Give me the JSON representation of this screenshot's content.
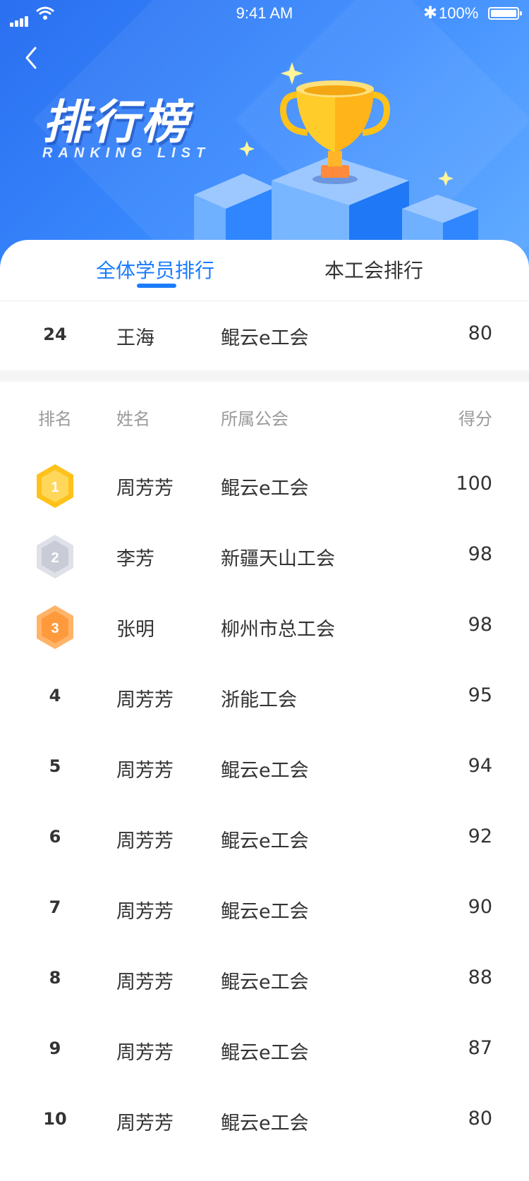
{
  "status": {
    "time": "9:41 AM",
    "battery": "100%"
  },
  "header": {
    "title": "排行榜",
    "subtitle": "RANKING LIST"
  },
  "tabs": [
    {
      "label": "全体学员排行",
      "active": true
    },
    {
      "label": "本工会排行",
      "active": false
    }
  ],
  "my_rank": {
    "rank": "24",
    "name": "王海",
    "union": "鲲云e工会",
    "score": "80"
  },
  "columns": {
    "rank": "排名",
    "name": "姓名",
    "union": "所属公会",
    "score": "得分"
  },
  "rows": [
    {
      "rank": "1",
      "name": "周芳芳",
      "union": "鲲云e工会",
      "score": "100"
    },
    {
      "rank": "2",
      "name": "李芳",
      "union": "新疆天山工会",
      "score": "98"
    },
    {
      "rank": "3",
      "name": "张明",
      "union": "柳州市总工会",
      "score": "98"
    },
    {
      "rank": "4",
      "name": "周芳芳",
      "union": "浙能工会",
      "score": "95"
    },
    {
      "rank": "5",
      "name": "周芳芳",
      "union": "鲲云e工会",
      "score": "94"
    },
    {
      "rank": "6",
      "name": "周芳芳",
      "union": "鲲云e工会",
      "score": "92"
    },
    {
      "rank": "7",
      "name": "周芳芳",
      "union": "鲲云e工会",
      "score": "90"
    },
    {
      "rank": "8",
      "name": "周芳芳",
      "union": "鲲云e工会",
      "score": "88"
    },
    {
      "rank": "9",
      "name": "周芳芳",
      "union": "鲲云e工会",
      "score": "87"
    },
    {
      "rank": "10",
      "name": "周芳芳",
      "union": "鲲云e工会",
      "score": "80"
    }
  ],
  "colors": {
    "accent": "#1a7cff",
    "gold": "#ffc21a",
    "silver": "#c9ccd6",
    "bronze": "#ff9a3c"
  },
  "icons": {
    "back": "chevron-left-icon",
    "trophy": "trophy-icon"
  }
}
